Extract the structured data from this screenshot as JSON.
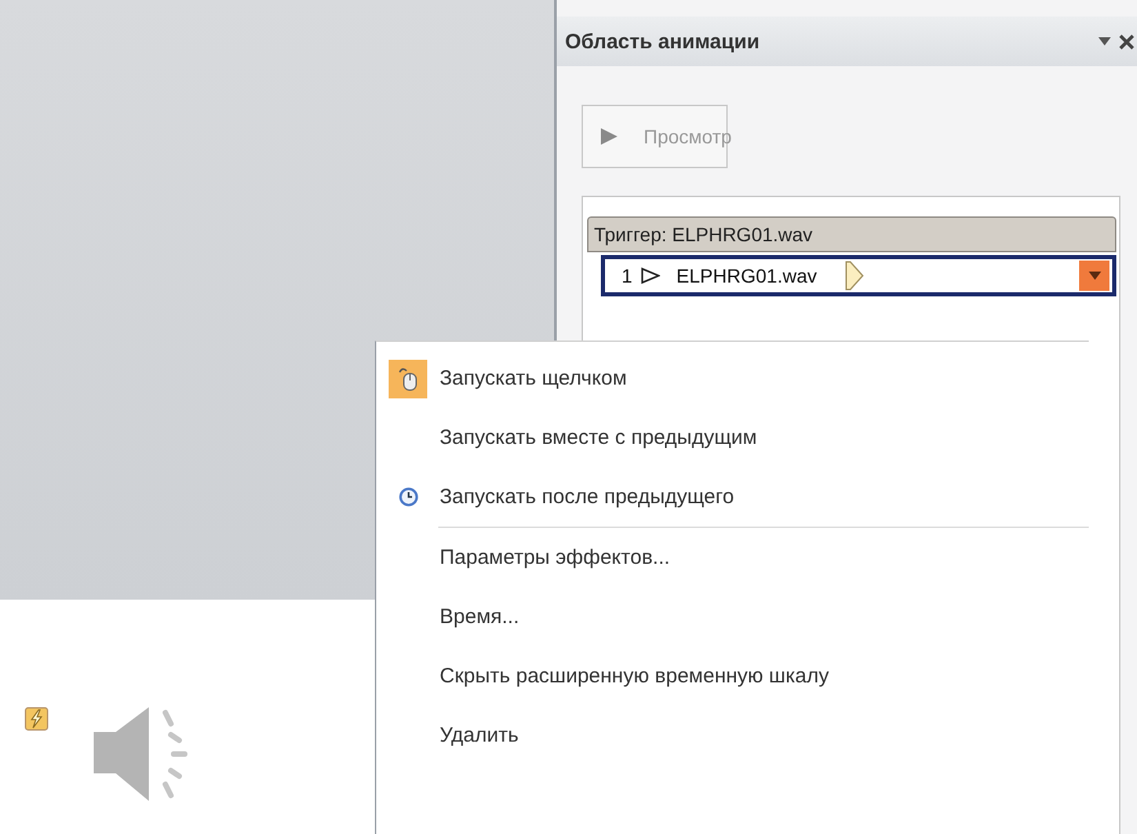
{
  "animation_pane": {
    "title": "Область анимации",
    "preview_button": {
      "label": "Просмотр",
      "disabled": true
    },
    "trigger": {
      "label": "Триггер: ELPHRG01.wav"
    },
    "effects": [
      {
        "number": "1",
        "name": "ELPHRG01.wav",
        "selected": true
      }
    ]
  },
  "context_menu": {
    "sections": [
      {
        "items": [
          {
            "label": "Запускать щелчком",
            "kind": "mouse",
            "checked": true
          },
          {
            "label": "Запускать вместе с предыдущим",
            "kind": "plain",
            "checked": false
          },
          {
            "label": "Запускать после предыдущего",
            "kind": "clock",
            "checked": false
          }
        ]
      },
      {
        "items": [
          {
            "label": "Параметры эффектов...",
            "kind": "plain",
            "checked": false
          },
          {
            "label": "Время...",
            "kind": "plain",
            "checked": false
          },
          {
            "label": "Скрыть расширенную временную шкалу",
            "kind": "plain",
            "checked": false
          },
          {
            "label": "Удалить",
            "kind": "plain",
            "checked": false
          }
        ]
      }
    ]
  }
}
